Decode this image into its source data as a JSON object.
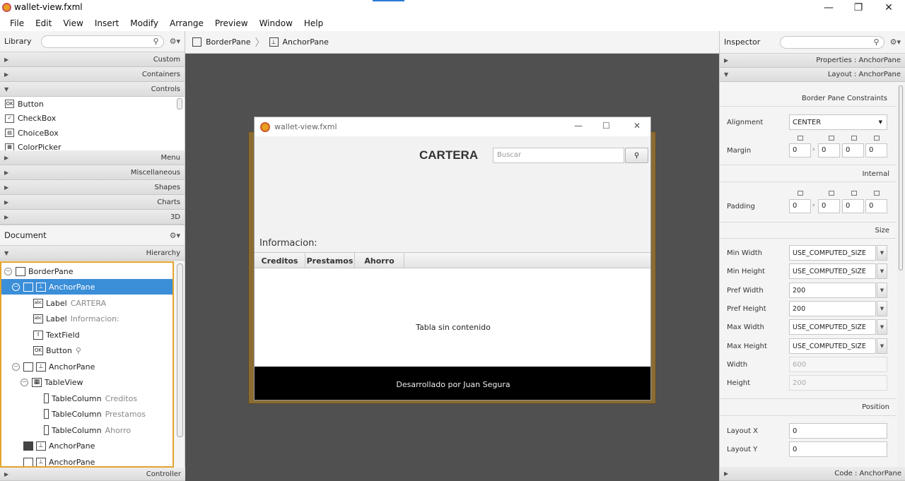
{
  "window": {
    "title": "wallet-view.fxml",
    "controls": {
      "minimize": "—",
      "maximize": "❐",
      "close": "✕"
    }
  },
  "menu": [
    "File",
    "Edit",
    "View",
    "Insert",
    "Modify",
    "Arrange",
    "Preview",
    "Window",
    "Help"
  ],
  "library": {
    "title": "Library",
    "sections_top": [
      "Custom",
      "Containers",
      "Controls"
    ],
    "controls": [
      {
        "icon": "OK",
        "label": "Button"
      },
      {
        "icon": "✓",
        "label": "CheckBox"
      },
      {
        "icon": "▤",
        "label": "ChoiceBox"
      },
      {
        "icon": "▦",
        "label": "ColorPicker"
      }
    ],
    "sections_bottom": [
      "Menu",
      "Miscellaneous",
      "Shapes",
      "Charts",
      "3D"
    ]
  },
  "document": {
    "title": "Document",
    "section": "Hierarchy",
    "footer": "Controller",
    "tree": [
      {
        "label": "BorderPane",
        "sub": ""
      },
      {
        "label": "AnchorPane",
        "sub": ""
      },
      {
        "label": "Label",
        "sub": "CARTERA"
      },
      {
        "label": "Label",
        "sub": "Informacion:"
      },
      {
        "label": "TextField",
        "sub": ""
      },
      {
        "label": "Button",
        "sub": "⚲"
      },
      {
        "label": "AnchorPane",
        "sub": ""
      },
      {
        "label": "TableView",
        "sub": ""
      },
      {
        "label": "TableColumn",
        "sub": "Creditos"
      },
      {
        "label": "TableColumn",
        "sub": "Prestamos"
      },
      {
        "label": "TableColumn",
        "sub": "Ahorro"
      },
      {
        "label": "AnchorPane",
        "sub": ""
      },
      {
        "label": "AnchorPane",
        "sub": ""
      }
    ]
  },
  "breadcrumb": [
    "BorderPane",
    "AnchorPane"
  ],
  "preview": {
    "title": "wallet-view.fxml",
    "heading": "CARTERA",
    "search_placeholder": "Buscar",
    "search_button": "⚲",
    "info_label": "Informacion:",
    "columns": [
      "Creditos",
      "Prestamos",
      "Ahorro"
    ],
    "empty_text": "Tabla sin contenido",
    "footer_text": "Desarrollado por Juan Segura"
  },
  "inspector": {
    "title": "Inspector",
    "properties_section": "Properties : AnchorPane",
    "layout_section": "Layout : AnchorPane",
    "code_section": "Code : AnchorPane",
    "border_pane_constraints": "Border Pane Constraints",
    "alignment_label": "Alignment",
    "alignment_value": "CENTER",
    "margin_label": "Margin",
    "margin_values": [
      "0",
      "0",
      "0",
      "0"
    ],
    "internal_label": "Internal",
    "padding_label": "Padding",
    "padding_values": [
      "0",
      "0",
      "0",
      "0"
    ],
    "size_label": "Size",
    "size_rows": [
      {
        "label": "Min Width",
        "value": "USE_COMPUTED_SIZE"
      },
      {
        "label": "Min Height",
        "value": "USE_COMPUTED_SIZE"
      },
      {
        "label": "Pref Width",
        "value": "200"
      },
      {
        "label": "Pref Height",
        "value": "200"
      },
      {
        "label": "Max Width",
        "value": "USE_COMPUTED_SIZE"
      },
      {
        "label": "Max Height",
        "value": "USE_COMPUTED_SIZE"
      }
    ],
    "width_label": "Width",
    "width_value": "600",
    "height_label": "Height",
    "height_value": "200",
    "position_label": "Position",
    "layout_x_label": "Layout X",
    "layout_x_value": "0",
    "layout_y_label": "Layout Y",
    "layout_y_value": "0"
  }
}
